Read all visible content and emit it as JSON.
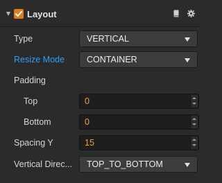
{
  "component": {
    "title": "Layout",
    "enabled": true,
    "icons": [
      "collapse-arrow-icon",
      "checkbox-icon",
      "book-icon",
      "gear-icon"
    ]
  },
  "fields": {
    "type": {
      "label": "Type",
      "value": "VERTICAL"
    },
    "resize_mode": {
      "label": "Resize Mode",
      "value": "CONTAINER",
      "label_color": "#2f9ef7"
    },
    "padding": {
      "label": "Padding"
    },
    "top": {
      "label": "Top",
      "value": "0"
    },
    "bottom": {
      "label": "Bottom",
      "value": "0"
    },
    "spacing_y": {
      "label": "Spacing Y",
      "value": "15"
    },
    "vertical_direction": {
      "label": "Vertical Direc...",
      "value": "TOP_TO_BOTTOM"
    }
  },
  "colors": {
    "background": "#2b2b2b",
    "accent_orange": "#e07a1f",
    "value_orange": "#f0a13a",
    "link_blue": "#2f9ef7"
  }
}
